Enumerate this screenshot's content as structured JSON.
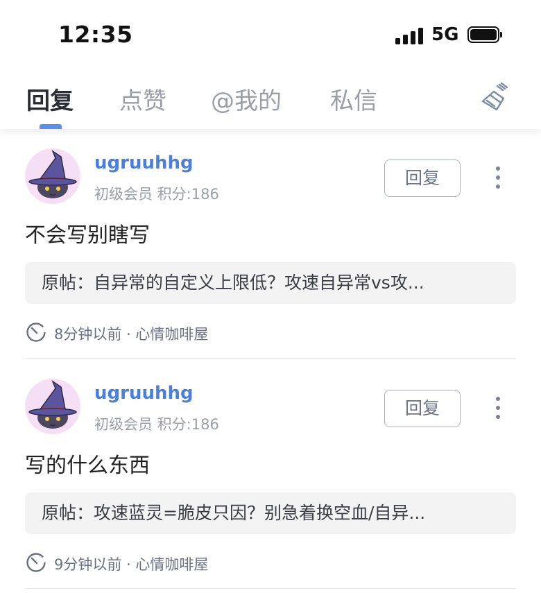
{
  "status_bar": {
    "time": "12:35",
    "network": "5G",
    "icons": [
      "signal-icon",
      "battery-icon"
    ]
  },
  "tabs": {
    "items": [
      {
        "label": "回复",
        "active": true
      },
      {
        "label": "点赞",
        "active": false
      },
      {
        "label": "@我的",
        "active": false
      },
      {
        "label": "私信",
        "active": false
      }
    ],
    "accent_color": "#5a8ff0",
    "clear_icon": "broom-icon"
  },
  "feed": {
    "items": [
      {
        "username": "ugruuhhg",
        "meta": "初级会员 积分:186",
        "reply_label": "回复",
        "comment": "不会写别瞎写",
        "quote": "原帖：自异常的自定义上限低？攻速自异常vs攻...",
        "time": "8分钟以前 · 心情咖啡屋"
      },
      {
        "username": "ugruuhhg",
        "meta": "初级会员 积分:186",
        "reply_label": "回复",
        "comment": "写的什么东西",
        "quote": "原帖：攻速蓝灵=脆皮只因？别急着换空血/自异...",
        "time": "9分钟以前 · 心情咖啡屋"
      }
    ],
    "username_color": "#4a7fdc"
  }
}
